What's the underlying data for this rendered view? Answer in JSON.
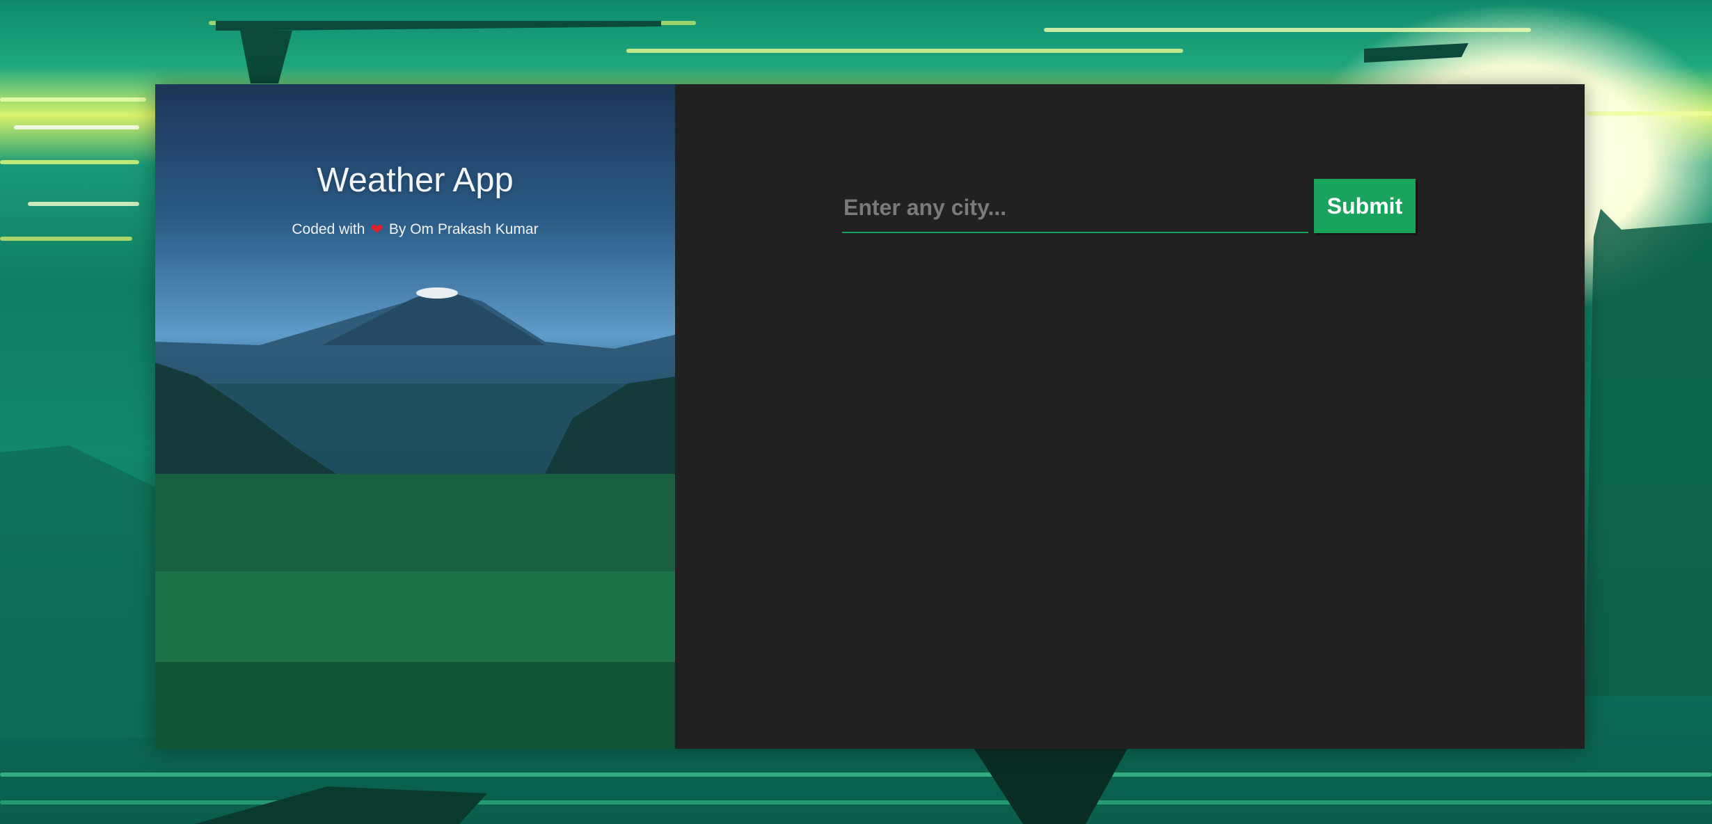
{
  "app": {
    "title": "Weather App",
    "credit_prefix": "Coded with",
    "credit_icon": "heart-icon",
    "credit_suffix": "By Om Prakash Kumar"
  },
  "search": {
    "placeholder": "Enter any city...",
    "value": "",
    "submit_label": "Submit"
  },
  "colors": {
    "accent": "#1aa35c",
    "panel": "#212121",
    "heart": "#e0202a"
  }
}
